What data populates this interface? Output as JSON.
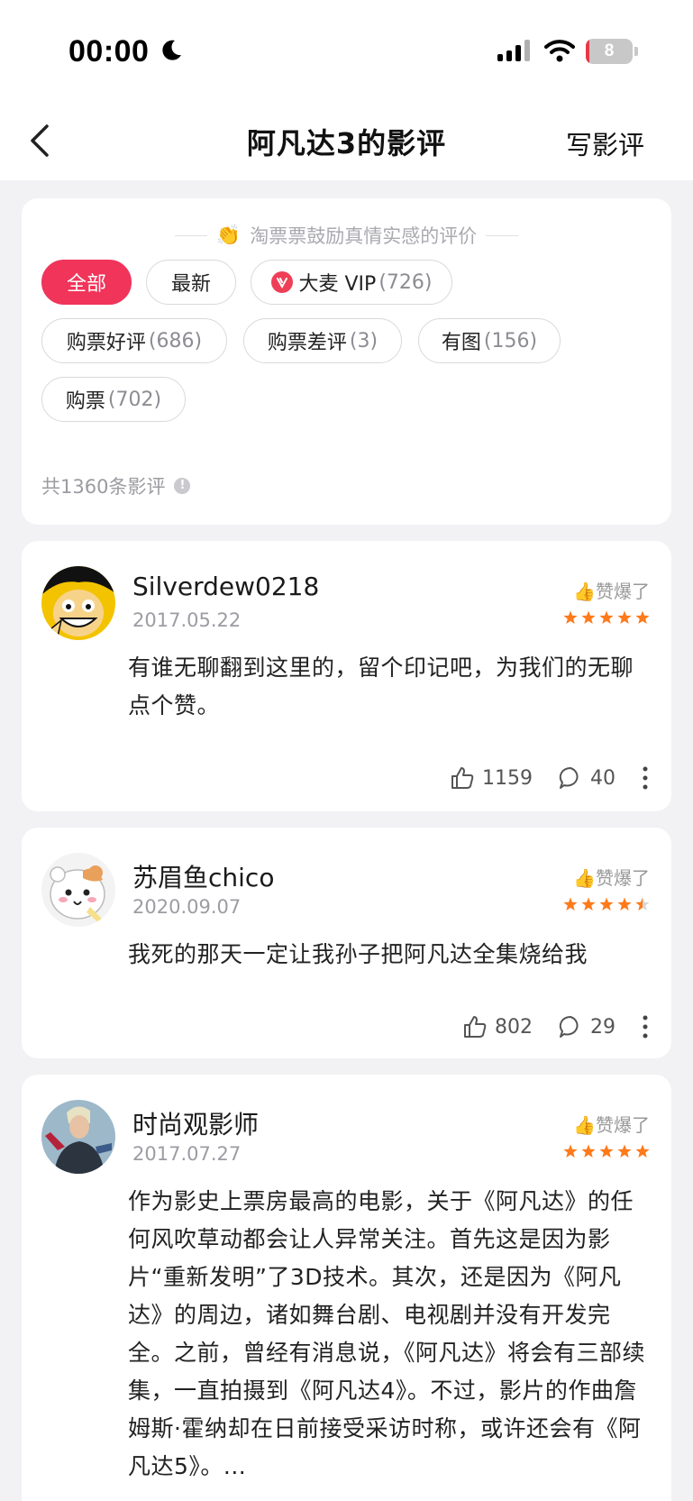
{
  "status": {
    "time": "00:00",
    "battery": "8",
    "battery_level": 0.08
  },
  "nav": {
    "title": "阿凡达3的影评",
    "write_label": "写影评"
  },
  "filter": {
    "encourage_text": "淘票票鼓励真情实感的评价",
    "chips": [
      {
        "label": "全部",
        "count": "",
        "active": true
      },
      {
        "label": "最新",
        "count": ""
      },
      {
        "label": "大麦 VIP",
        "count": "(726)"
      },
      {
        "label": "购票好评",
        "count": "(686)"
      },
      {
        "label": "购票差评",
        "count": "(3)"
      },
      {
        "label": "有图",
        "count": "(156)"
      },
      {
        "label": "购票",
        "count": "(702)"
      }
    ],
    "total_text": "共1360条影评"
  },
  "reviews": [
    {
      "name": "Silverdew0218",
      "date": "2017.05.22",
      "badge": "👍赞爆了",
      "rating": 5,
      "text": "有谁无聊翻到这里的，留个印记吧，为我们的无聊点个赞。",
      "likes": "1159",
      "comments": "40"
    },
    {
      "name": "苏眉鱼chico",
      "date": "2020.09.07",
      "badge": "👍赞爆了",
      "rating": 4.5,
      "text": "我死的那天一定让我孙子把阿凡达全集烧给我",
      "likes": "802",
      "comments": "29"
    },
    {
      "name": "时尚观影师",
      "date": "2017.07.27",
      "badge": "👍赞爆了",
      "rating": 5,
      "text": "作为影史上票房最高的电影，关于《阿凡达》的任何风吹草动都会让人异常关注。首先这是因为影片“重新发明”了3D技术。其次，还是因为《阿凡达》的周边，诸如舞台剧、电视剧并没有开发完全。之前，曾经有消息说，《阿凡达》将会有三部续集，一直拍摄到《阿凡达4》。不过，影片的作曲詹姆斯·霍纳却在日前接受采访时称，或许还会有《阿凡达5》。..."
    }
  ],
  "colors": {
    "accent": "#f0345a",
    "star": "#ff7a1a",
    "star_empty": "#d6d6d6"
  }
}
